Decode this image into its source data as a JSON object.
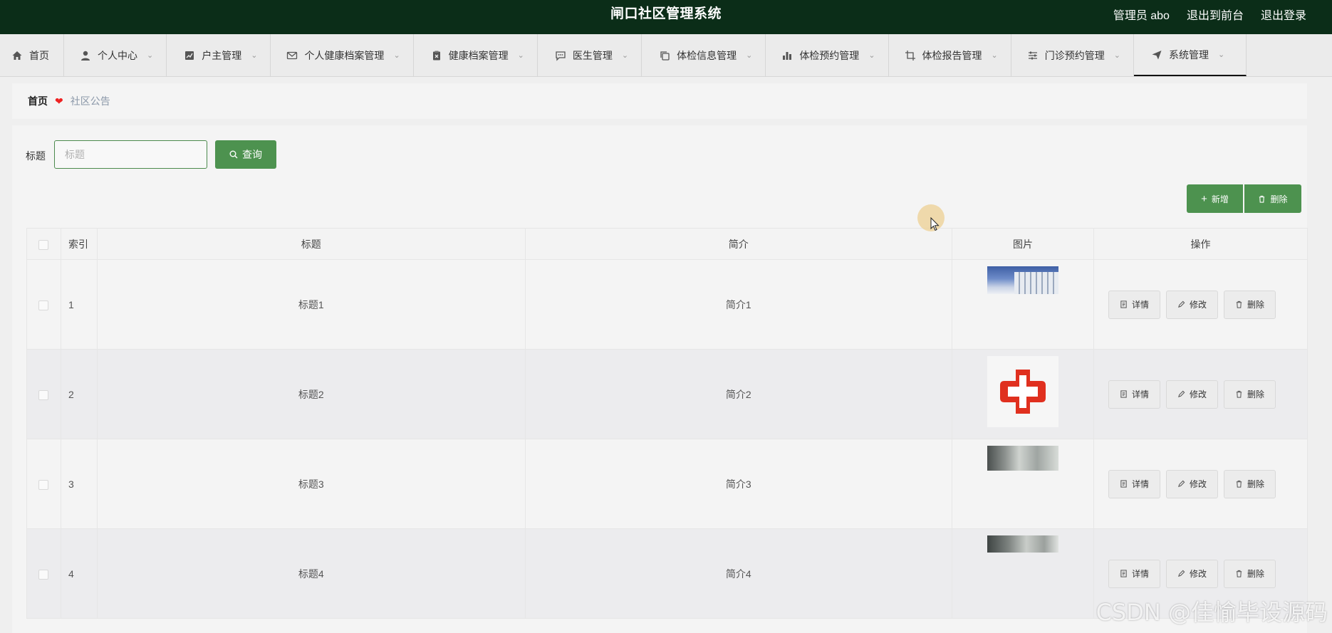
{
  "header": {
    "title": "闸口社区管理系统",
    "user": "管理员 abo",
    "to_front": "退出到前台",
    "logout": "退出登录"
  },
  "nav": [
    {
      "label": "首页",
      "icon": "home-icon",
      "dropdown": false
    },
    {
      "label": "个人中心",
      "icon": "user-icon",
      "dropdown": true
    },
    {
      "label": "户主管理",
      "icon": "chart-icon",
      "dropdown": true
    },
    {
      "label": "个人健康档案管理",
      "icon": "mail-icon",
      "dropdown": true
    },
    {
      "label": "健康档案管理",
      "icon": "clipboard-icon",
      "dropdown": true
    },
    {
      "label": "医生管理",
      "icon": "chat-icon",
      "dropdown": true
    },
    {
      "label": "体检信息管理",
      "icon": "copy-icon",
      "dropdown": true
    },
    {
      "label": "体检预约管理",
      "icon": "bar-chart-icon",
      "dropdown": true
    },
    {
      "label": "体检报告管理",
      "icon": "crop-icon",
      "dropdown": true
    },
    {
      "label": "门诊预约管理",
      "icon": "sliders-icon",
      "dropdown": true
    },
    {
      "label": "系统管理",
      "icon": "send-icon",
      "dropdown": true,
      "active": true
    }
  ],
  "breadcrumb": {
    "home": "首页",
    "current": "社区公告"
  },
  "search": {
    "label": "标题",
    "placeholder": "标题",
    "value": "",
    "button": "查询"
  },
  "toolbar": {
    "add": "新增",
    "delete": "删除"
  },
  "table": {
    "headers": {
      "index": "索引",
      "title": "标题",
      "intro": "简介",
      "image": "图片",
      "ops": "操作"
    },
    "rows": [
      {
        "index": "1",
        "title": "标题1",
        "intro": "简介1",
        "image": "building"
      },
      {
        "index": "2",
        "title": "标题2",
        "intro": "简介2",
        "image": "red-cross"
      },
      {
        "index": "3",
        "title": "标题3",
        "intro": "简介3",
        "image": "hall"
      },
      {
        "index": "4",
        "title": "标题4",
        "intro": "简介4",
        "image": "hall"
      }
    ],
    "row_actions": {
      "detail": "详情",
      "edit": "修改",
      "delete": "删除"
    }
  },
  "watermark": "CSDN @佳愉毕设源码",
  "colors": {
    "header_bg": "#0b2d18",
    "primary": "#4d924f",
    "heart": "#e22222"
  }
}
